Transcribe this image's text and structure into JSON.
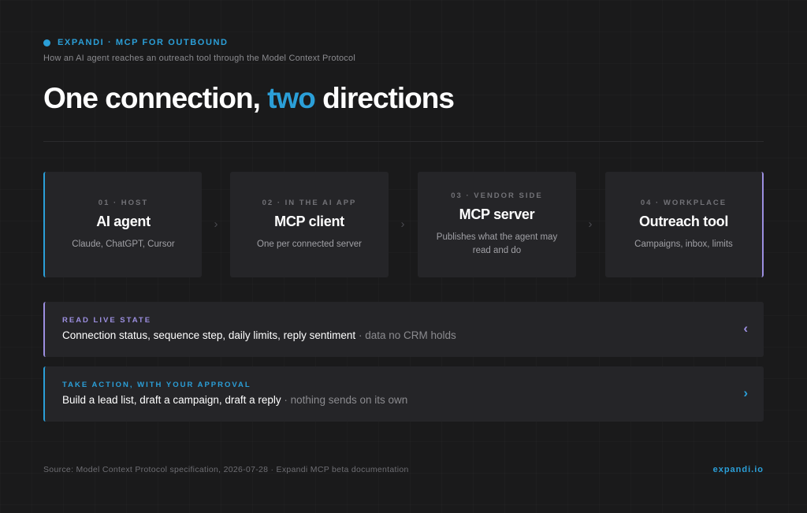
{
  "header": {
    "eyebrow": "EXPANDI · MCP FOR OUTBOUND",
    "subtitle": "How an AI agent reaches an outreach tool through the Model Context Protocol",
    "headline_before": "One connection, ",
    "headline_accent": "two",
    "headline_after": " directions"
  },
  "steps": [
    {
      "tag": "01 · HOST",
      "title": "AI agent",
      "desc": "Claude, ChatGPT, Cursor"
    },
    {
      "tag": "02 · IN THE AI APP",
      "title": "MCP client",
      "desc": "One per connected server"
    },
    {
      "tag": "03 · VENDOR SIDE",
      "title": "MCP server",
      "desc": "Publishes what the agent may read and do"
    },
    {
      "tag": "04 · WORKPLACE",
      "title": "Outreach tool",
      "desc": "Campaigns, inbox, limits"
    }
  ],
  "arrow_glyph": "›",
  "flows": {
    "read": {
      "label": "READ LIVE STATE",
      "text": "Connection status, sequence step, daily limits, reply sentiment",
      "separator": " · ",
      "note": "data no CRM holds",
      "chevron": "‹",
      "icon": "chevron-left-icon"
    },
    "act": {
      "label": "TAKE ACTION, WITH YOUR APPROVAL",
      "text": "Build a lead list, draft a campaign, draft a reply",
      "separator": " · ",
      "note": "nothing sends on its own",
      "chevron": "›",
      "icon": "chevron-right-icon"
    }
  },
  "footer": {
    "source": "Source: Model Context Protocol specification, 2026-07-28 · Expandi MCP beta documentation",
    "brand": "expandi.io"
  },
  "colors": {
    "background": "#1a1a1b",
    "card": "#252528",
    "accent_blue": "#2b9fd8",
    "accent_purple": "#9c8fe0"
  }
}
